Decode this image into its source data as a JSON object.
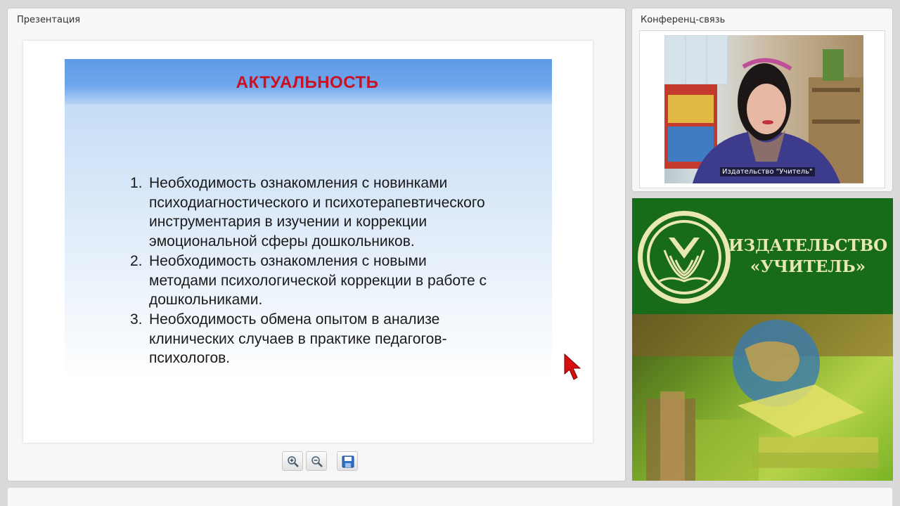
{
  "presentation": {
    "title": "Презентация",
    "slide": {
      "heading": "АКТУАЛЬНОСТЬ",
      "items": [
        {
          "number": "1.",
          "lines": [
            "Необходимость ознакомления с  новинками",
            "психодиагностического  и психотерапевтического",
            "инструментария в изучении  и коррекции",
            "эмоциональной сферы дошкольников."
          ]
        },
        {
          "number": "2.",
          "lines": [
            "Необходимость ознакомления с новыми",
            "методами психологической коррекции в работе с",
            "дошкольниками."
          ]
        },
        {
          "number": "3.",
          "lines": [
            "Необходимость обмена опытом в анализе",
            "клинических случаев в практике педагогов-",
            "психологов."
          ]
        }
      ]
    },
    "toolbar": [
      "zoom-in-icon",
      "zoom-out-icon",
      "save-icon"
    ]
  },
  "conference": {
    "title": "Конференц-связь",
    "participant_name": "Издательство \"Учитель\""
  },
  "publisher": {
    "name_line1": "ИЗДАТЕЛЬСТВО",
    "name_line2": "«УЧИТЕЛЬ»"
  },
  "colors": {
    "slide_heading": "#cc1020",
    "banner_green": "#176b1b",
    "banner_text": "#e9e8b0"
  }
}
